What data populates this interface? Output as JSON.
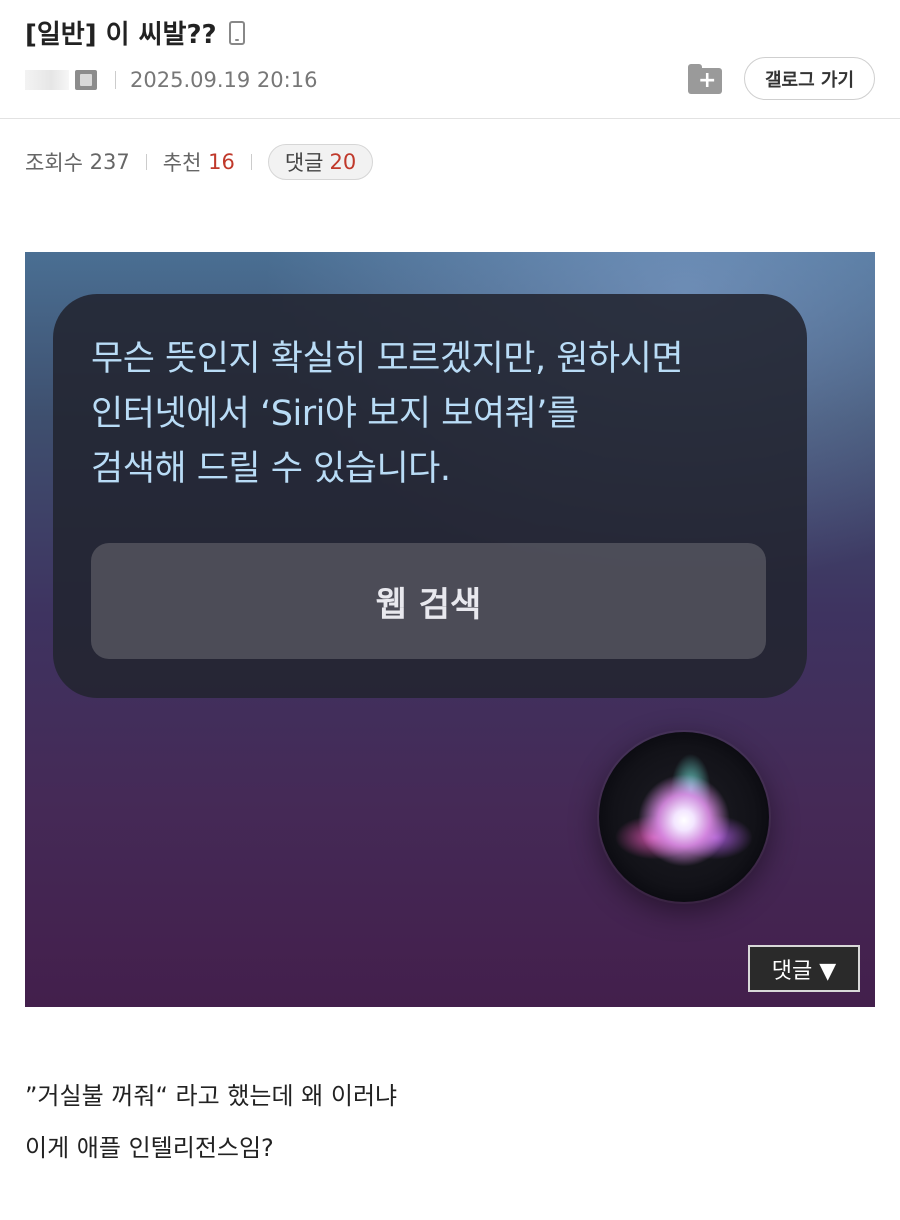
{
  "post": {
    "title": "[일반] 이 씨발??",
    "device_icon": "mobile-phone-icon",
    "author_icon": "gonick-member-icon",
    "datetime": "2025.09.19 20:16",
    "views_label": "조회수",
    "views": "237",
    "recommend_label": "추천",
    "recommend": "16",
    "comments_label": "댓글",
    "comments": "20"
  },
  "header": {
    "save_icon": "folder-plus-icon",
    "gallery_button_label": "갤로그 가기"
  },
  "image": {
    "siri_lines": [
      "무슨 뜻인지 확실히 모르겠지만, 원하시면",
      "인터넷에서 ‘Siri야 보지 보여줘’를",
      "검색해 드릴 수 있습니다."
    ],
    "web_search_label": "웹 검색",
    "siri_orb_icon": "siri-orb-icon",
    "comment_toggle_label": "댓글 ▼"
  },
  "body": {
    "lines": [
      "”거실불 꺼줘“ 라고 했는데 왜 이러냐",
      "이게 애플 인텔리전스임?"
    ]
  },
  "colors": {
    "accent_red": "#c0392b",
    "siri_text": "#b9dcf6"
  }
}
